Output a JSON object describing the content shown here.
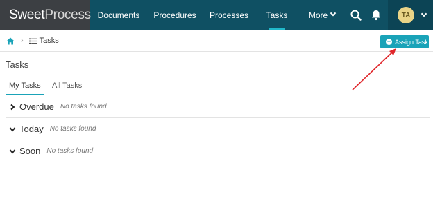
{
  "brand": {
    "word1": "Sweet",
    "word2": "Process"
  },
  "nav": {
    "items": [
      {
        "label": "Documents"
      },
      {
        "label": "Procedures"
      },
      {
        "label": "Processes"
      },
      {
        "label": "Tasks",
        "active": true
      },
      {
        "label": "More"
      }
    ]
  },
  "user": {
    "initials": "TA"
  },
  "breadcrumb": {
    "current": "Tasks"
  },
  "actions": {
    "assign_task": "Assign Task"
  },
  "page": {
    "title": "Tasks"
  },
  "tabs": [
    {
      "label": "My Tasks",
      "active": true
    },
    {
      "label": "All Tasks",
      "active": false
    }
  ],
  "sections": [
    {
      "title": "Overdue",
      "empty_text": "No tasks found",
      "state": "collapsed"
    },
    {
      "title": "Today",
      "empty_text": "No tasks found",
      "state": "expanded"
    },
    {
      "title": "Soon",
      "empty_text": "No tasks found",
      "state": "expanded"
    }
  ],
  "colors": {
    "nav_bg": "#0f5063",
    "logo_bg": "#3c3f43",
    "accent": "#1aa3b8",
    "annotation_arrow": "#e0262b"
  }
}
